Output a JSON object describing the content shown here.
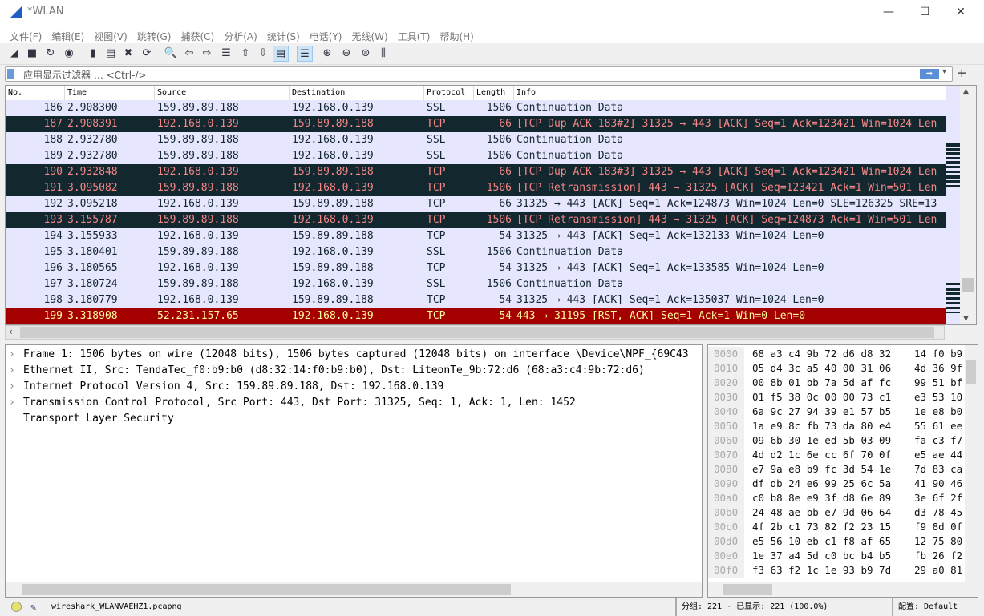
{
  "window": {
    "title": "*WLAN"
  },
  "menu": [
    "文件(F)",
    "编辑(E)",
    "视图(V)",
    "跳转(G)",
    "捕获(C)",
    "分析(A)",
    "统计(S)",
    "电话(Y)",
    "无线(W)",
    "工具(T)",
    "帮助(H)"
  ],
  "toolbar": [
    {
      "icon": "shark-fin-start-icon",
      "g": "◢"
    },
    {
      "icon": "stop-icon",
      "g": "■"
    },
    {
      "icon": "restart-icon",
      "g": "↻"
    },
    {
      "icon": "capture-options-icon",
      "g": "◉"
    },
    {
      "icon": "open-file-icon",
      "g": "▮"
    },
    {
      "icon": "save-file-icon",
      "g": "▤"
    },
    {
      "icon": "close-file-icon",
      "g": "✖"
    },
    {
      "icon": "reload-icon",
      "g": "⟳"
    },
    {
      "icon": "find-packet-icon",
      "g": "🔍"
    },
    {
      "icon": "go-back-icon",
      "g": "⇦"
    },
    {
      "icon": "go-forward-icon",
      "g": "⇨"
    },
    {
      "icon": "go-to-packet-icon",
      "g": "☰"
    },
    {
      "icon": "first-packet-icon",
      "g": "⇧"
    },
    {
      "icon": "last-packet-icon",
      "g": "⇩"
    },
    {
      "icon": "autoscroll-icon",
      "g": "▤"
    },
    {
      "icon": "colorize-icon",
      "g": "☰"
    },
    {
      "icon": "zoom-in-icon",
      "g": "⊕"
    },
    {
      "icon": "zoom-out-icon",
      "g": "⊖"
    },
    {
      "icon": "zoom-normal-icon",
      "g": "⊜"
    },
    {
      "icon": "resize-columns-icon",
      "g": "⫼"
    }
  ],
  "filter": {
    "placeholder": "应用显示过滤器 … <Ctrl-/>",
    "apply_icon": "arrow-right-icon",
    "add_label": "+"
  },
  "packet_list": {
    "columns": [
      "No.",
      "Time",
      "Source",
      "Destination",
      "Protocol",
      "Length",
      "Info"
    ],
    "rows": [
      {
        "no": "186",
        "time": "2.908300",
        "src": "159.89.89.188",
        "dst": "192.168.0.139",
        "proto": "SSL",
        "len": "1506",
        "info": "Continuation Data",
        "style": "normal"
      },
      {
        "no": "187",
        "time": "2.908391",
        "src": "192.168.0.139",
        "dst": "159.89.89.188",
        "proto": "TCP",
        "len": "66",
        "info": "[TCP Dup ACK 183#2] 31325 → 443 [ACK] Seq=1 Ack=123421 Win=1024 Len",
        "style": "bad"
      },
      {
        "no": "188",
        "time": "2.932780",
        "src": "159.89.89.188",
        "dst": "192.168.0.139",
        "proto": "SSL",
        "len": "1506",
        "info": "Continuation Data",
        "style": "normal"
      },
      {
        "no": "189",
        "time": "2.932780",
        "src": "159.89.89.188",
        "dst": "192.168.0.139",
        "proto": "SSL",
        "len": "1506",
        "info": "Continuation Data",
        "style": "normal"
      },
      {
        "no": "190",
        "time": "2.932848",
        "src": "192.168.0.139",
        "dst": "159.89.89.188",
        "proto": "TCP",
        "len": "66",
        "info": "[TCP Dup ACK 183#3] 31325 → 443 [ACK] Seq=1 Ack=123421 Win=1024 Len",
        "style": "bad"
      },
      {
        "no": "191",
        "time": "3.095082",
        "src": "159.89.89.188",
        "dst": "192.168.0.139",
        "proto": "TCP",
        "len": "1506",
        "info": "[TCP Retransmission] 443 → 31325 [ACK] Seq=123421 Ack=1 Win=501 Len",
        "style": "bad"
      },
      {
        "no": "192",
        "time": "3.095218",
        "src": "192.168.0.139",
        "dst": "159.89.89.188",
        "proto": "TCP",
        "len": "66",
        "info": "31325 → 443 [ACK] Seq=1 Ack=124873 Win=1024 Len=0 SLE=126325 SRE=13",
        "style": "normal"
      },
      {
        "no": "193",
        "time": "3.155787",
        "src": "159.89.89.188",
        "dst": "192.168.0.139",
        "proto": "TCP",
        "len": "1506",
        "info": "[TCP Retransmission] 443 → 31325 [ACK] Seq=124873 Ack=1 Win=501 Len",
        "style": "bad"
      },
      {
        "no": "194",
        "time": "3.155933",
        "src": "192.168.0.139",
        "dst": "159.89.89.188",
        "proto": "TCP",
        "len": "54",
        "info": "31325 → 443 [ACK] Seq=1 Ack=132133 Win=1024 Len=0",
        "style": "normal"
      },
      {
        "no": "195",
        "time": "3.180401",
        "src": "159.89.89.188",
        "dst": "192.168.0.139",
        "proto": "SSL",
        "len": "1506",
        "info": "Continuation Data",
        "style": "normal"
      },
      {
        "no": "196",
        "time": "3.180565",
        "src": "192.168.0.139",
        "dst": "159.89.89.188",
        "proto": "TCP",
        "len": "54",
        "info": "31325 → 443 [ACK] Seq=1 Ack=133585 Win=1024 Len=0",
        "style": "normal"
      },
      {
        "no": "197",
        "time": "3.180724",
        "src": "159.89.89.188",
        "dst": "192.168.0.139",
        "proto": "SSL",
        "len": "1506",
        "info": "Continuation Data",
        "style": "normal"
      },
      {
        "no": "198",
        "time": "3.180779",
        "src": "192.168.0.139",
        "dst": "159.89.89.188",
        "proto": "TCP",
        "len": "54",
        "info": "31325 → 443 [ACK] Seq=1 Ack=135037 Win=1024 Len=0",
        "style": "normal"
      },
      {
        "no": "199",
        "time": "3.318908",
        "src": "52.231.157.65",
        "dst": "192.168.0.139",
        "proto": "TCP",
        "len": "54",
        "info": "443 → 31195 [RST, ACK] Seq=1 Ack=1 Win=0 Len=0",
        "style": "rst"
      }
    ]
  },
  "colors": {
    "normal_bg": "#e7e6ff",
    "normal_fg": "#12272e",
    "bad_bg": "#12272e",
    "bad_fg": "#f78787",
    "rst_bg": "#a40000",
    "rst_fg": "#fffc9c"
  },
  "details": [
    {
      "text": "Frame 1: 1506 bytes on wire (12048 bits), 1506 bytes captured (12048 bits) on interface \\Device\\NPF_{69C43",
      "expandable": true
    },
    {
      "text": "Ethernet II, Src: TendaTec_f0:b9:b0 (d8:32:14:f0:b9:b0), Dst: LiteonTe_9b:72:d6 (68:a3:c4:9b:72:d6)",
      "expandable": true
    },
    {
      "text": "Internet Protocol Version 4, Src: 159.89.89.188, Dst: 192.168.0.139",
      "expandable": true
    },
    {
      "text": "Transmission Control Protocol, Src Port: 443, Dst Port: 31325, Seq: 1, Ack: 1, Len: 1452",
      "expandable": true
    },
    {
      "text": "Transport Layer Security",
      "expandable": false
    }
  ],
  "hex": [
    [
      "0000",
      "68 a3 c4 9b 72 d6 d8 32",
      "14 f0 b9"
    ],
    [
      "0010",
      "05 d4 3c a5 40 00 31 06",
      "4d 36 9f"
    ],
    [
      "0020",
      "00 8b 01 bb 7a 5d af fc",
      "99 51 bf"
    ],
    [
      "0030",
      "01 f5 38 0c 00 00 73 c1",
      "e3 53 10"
    ],
    [
      "0040",
      "6a 9c 27 94 39 e1 57 b5",
      "1e e8 b0"
    ],
    [
      "0050",
      "1a e9 8c fb 73 da 80 e4",
      "55 61 ee"
    ],
    [
      "0060",
      "09 6b 30 1e ed 5b 03 09",
      "fa c3 f7"
    ],
    [
      "0070",
      "4d d2 1c 6e cc 6f 70 0f",
      "e5 ae 44"
    ],
    [
      "0080",
      "e7 9a e8 b9 fc 3d 54 1e",
      "7d 83 ca"
    ],
    [
      "0090",
      "df db 24 e6 99 25 6c 5a",
      "41 90 46"
    ],
    [
      "00a0",
      "c0 b8 8e e9 3f d8 6e 89",
      "3e 6f 2f"
    ],
    [
      "00b0",
      "24 48 ae bb e7 9d 06 64",
      "d3 78 45"
    ],
    [
      "00c0",
      "4f 2b c1 73 82 f2 23 15",
      "f9 8d 0f"
    ],
    [
      "00d0",
      "e5 56 10 eb c1 f8 af 65",
      "12 75 80"
    ],
    [
      "00e0",
      "1e 37 a4 5d c0 bc b4 b5",
      "fb 26 f2"
    ],
    [
      "00f0",
      "f3 63 f2 1c 1e 93 b9 7d",
      "29 a0 81"
    ]
  ],
  "status": {
    "file": "wireshark_WLANVAEHZ1.pcapng",
    "packets": "分组: 221 · 已显示: 221 (100.0%)",
    "profile": "配置: Default"
  }
}
